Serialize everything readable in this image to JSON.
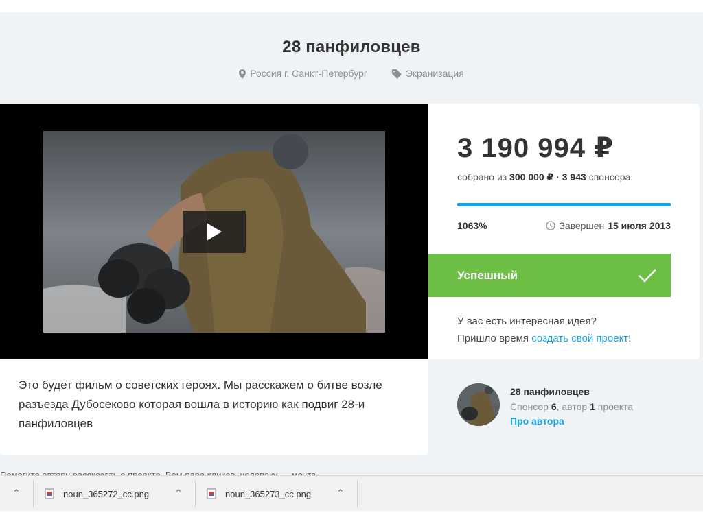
{
  "project": {
    "title": "28 панфиловцев",
    "location": "Россия г. Санкт-Петербург",
    "category": "Экранизация"
  },
  "funding": {
    "amount": "3 190 994 ₽",
    "collected_prefix": "собрано из",
    "goal": "300 000 ₽",
    "separator": "·",
    "sponsors": "3 943",
    "sponsors_label": "спонсора",
    "progress_fraction": 1.0,
    "percent": "1063%",
    "ended_label": "Завершен",
    "ended_date": "15 июля 2013",
    "status": "Успешный",
    "idea_line1": "У вас есть интересная идея?",
    "idea_line2_prefix": "Пришло время",
    "idea_link": "создать свой проект",
    "idea_line2_suffix": "!"
  },
  "description": "Это будет фильм о советских героях. Мы расскажем о битве возле разъезда Дубосеково которая вошла в историю как подвиг 28-и панфиловцев",
  "author": {
    "name": "28 панфиловцев",
    "stats_sponsor": "Спонсор",
    "stats_sponsor_count": "6",
    "stats_author": ", автор",
    "stats_author_count": "1",
    "stats_projects": "проекта",
    "link": "Про автора"
  },
  "cut_text": "Помогите автору рассказать о проекте. Вам пара кликов, человеку — мечта",
  "downloads": [
    {
      "name": "noun_365272_cc.png"
    },
    {
      "name": "noun_365273_cc.png"
    }
  ],
  "colors": {
    "accent": "#16a5e1",
    "success": "#6cbe45"
  },
  "icons": {
    "location": "map-pin-icon",
    "category": "tag-icon",
    "ended": "clock-icon",
    "status": "checkmark-icon",
    "play": "play-icon",
    "download_file": "image-file-icon",
    "expand": "chevron-up-icon"
  }
}
